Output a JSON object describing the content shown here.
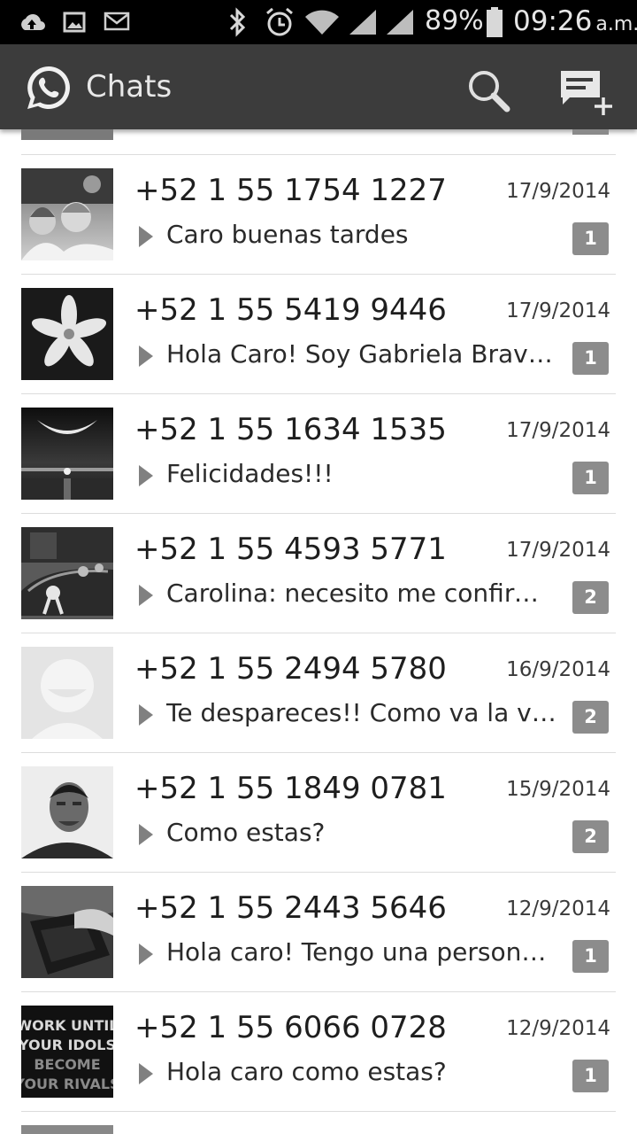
{
  "status_bar": {
    "battery_percent": "89%",
    "time": "09:26",
    "ampm": "a.m.",
    "icons": [
      "upload-icon",
      "image-icon",
      "email-icon",
      "bluetooth-icon",
      "alarm-icon",
      "wifi-icon",
      "signal-icon",
      "signal-icon",
      "battery-icon"
    ]
  },
  "app_bar": {
    "title": "Chats",
    "logo_icon": "whatsapp-logo-icon",
    "search_icon": "search-icon",
    "new_chat_icon": "new-chat-icon"
  },
  "chats": [
    {
      "name": "+52 1 55 1754 1227",
      "date": "17/9/2014",
      "preview": "Caro buenas tardes",
      "unread": "1",
      "avatar": "photo-adult-child"
    },
    {
      "name": "+52 1 55 5419 9446",
      "date": "17/9/2014",
      "preview": "Hola Caro! Soy Gabriela Bravo…",
      "unread": "1",
      "avatar": "photo-flower"
    },
    {
      "name": "+52 1 55 1634 1535",
      "date": "17/9/2014",
      "preview": "Felicidades!!!",
      "unread": "1",
      "avatar": "photo-moon-sea"
    },
    {
      "name": "+52 1 55 4593 5771",
      "date": "17/9/2014",
      "preview": "Carolina: necesito me confirm…",
      "unread": "2",
      "avatar": "photo-car"
    },
    {
      "name": "+52 1 55 2494 5780",
      "date": "16/9/2014",
      "preview": "Te despareces!! Como va la vi…",
      "unread": "2",
      "avatar": "default-avatar"
    },
    {
      "name": "+52 1 55 1849 0781",
      "date": "15/9/2014",
      "preview": "Como estas?",
      "unread": "2",
      "avatar": "photo-man"
    },
    {
      "name": "+52 1 55 2443 5646",
      "date": "12/9/2014",
      "preview": "Hola caro! Tengo una persona…",
      "unread": "1",
      "avatar": "photo-laptop"
    },
    {
      "name": "+52 1 55 6066 0728",
      "date": "12/9/2014",
      "preview": "Hola caro como estas?",
      "unread": "1",
      "avatar": "photo-text-quote"
    }
  ],
  "avatar_text": {
    "line1": "WORK UNTIL",
    "line2": "YOUR IDOLS",
    "line3": "BECOME",
    "line4": "YOUR RIVALS"
  }
}
